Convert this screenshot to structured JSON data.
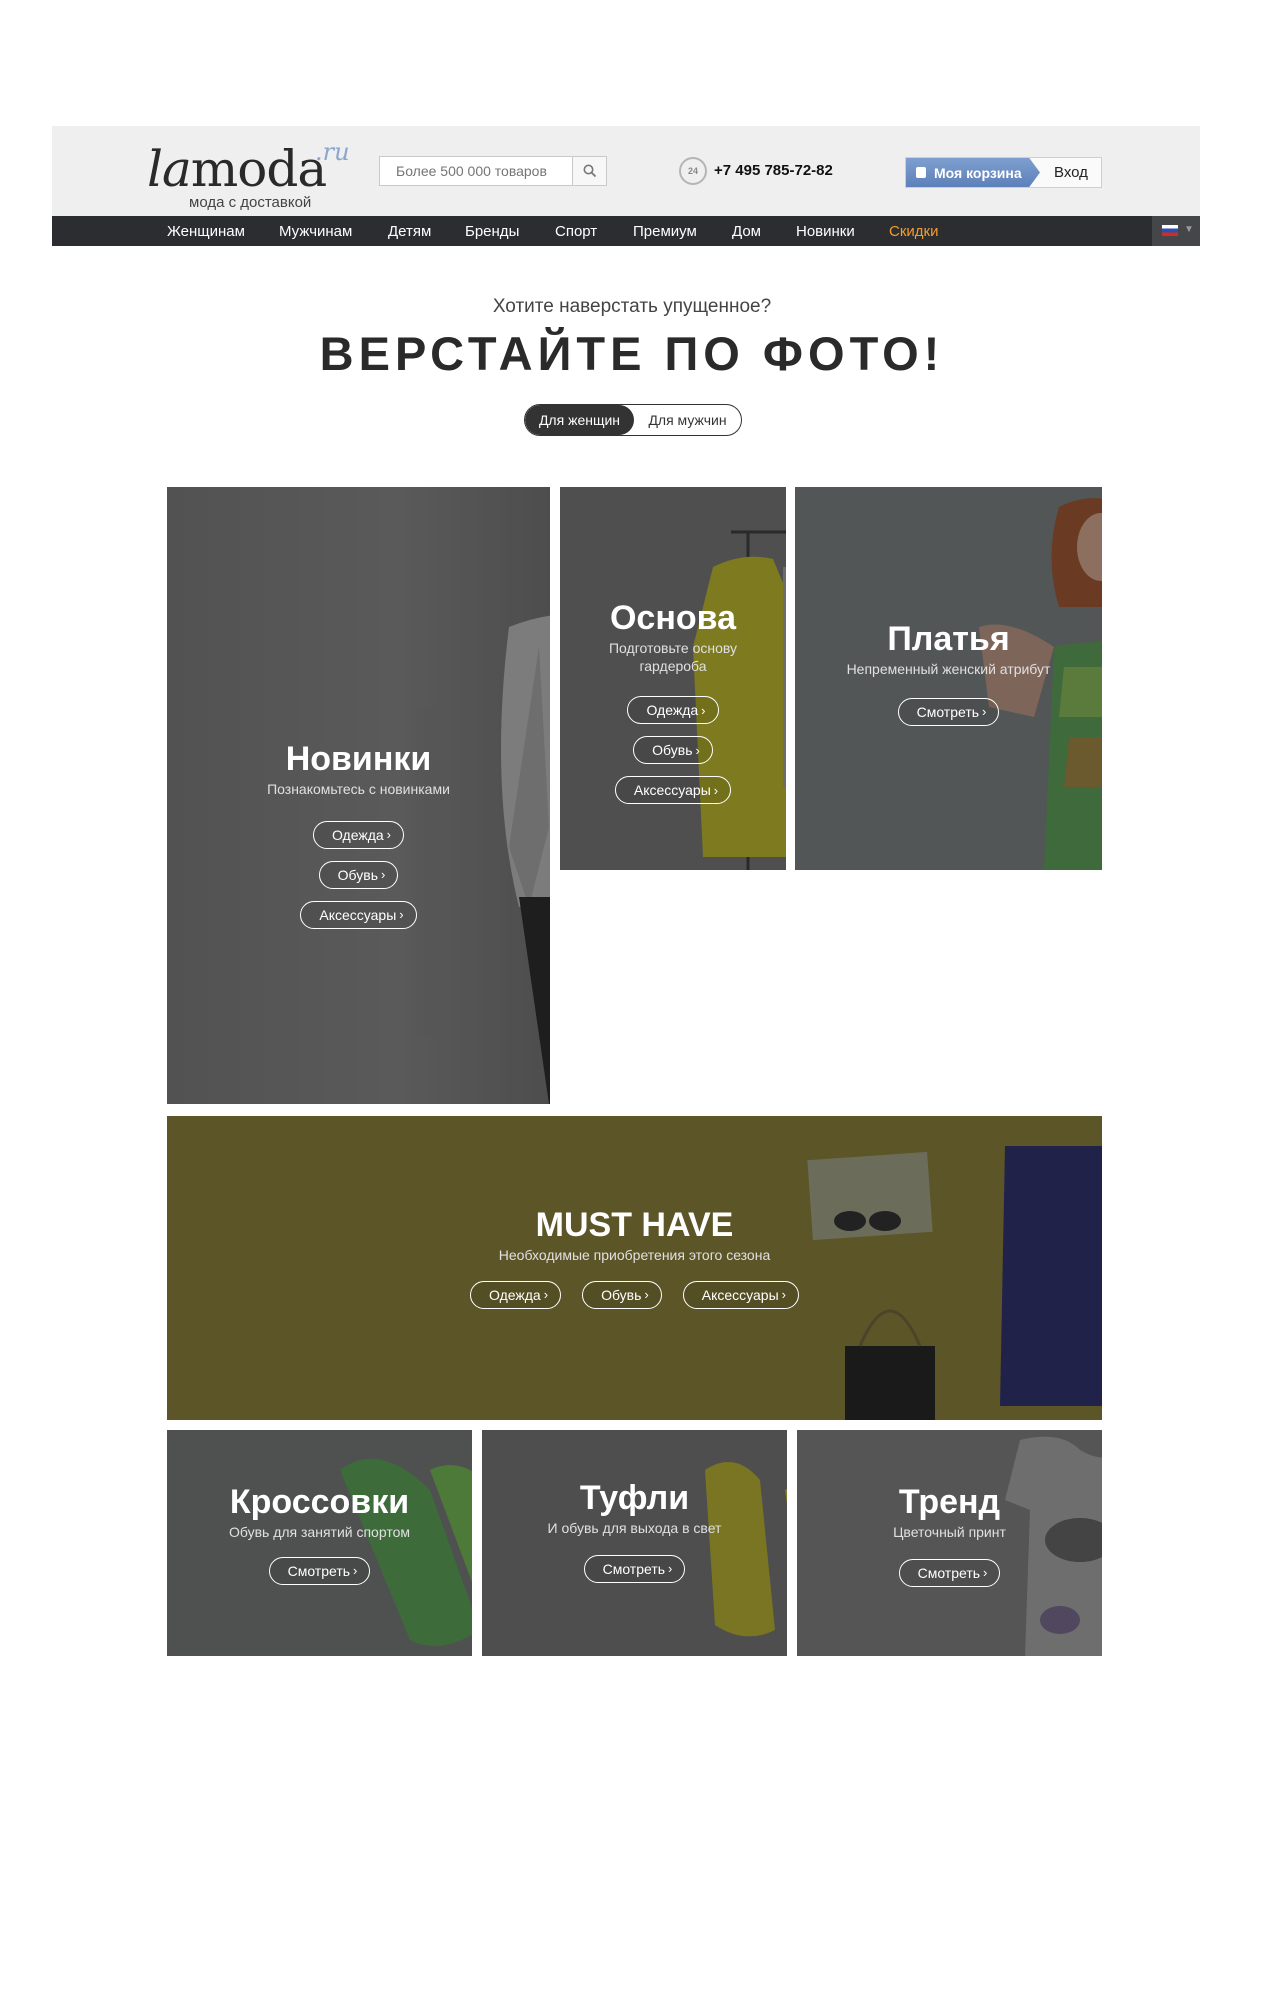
{
  "header": {
    "logo_la": "la",
    "logo_moda": "moda",
    "logo_ru": ".ru",
    "logo_tagline": "мода с доставкой",
    "search_placeholder": "Более 500 000 товаров",
    "phone_icon_text": "24",
    "phone": "+7 495 785-72-82",
    "cart_label": "Моя корзина",
    "login_label": "Вход"
  },
  "nav": {
    "items": [
      "Женщинам",
      "Мужчинам",
      "Детям",
      "Бренды",
      "Спорт",
      "Премиум",
      "Дом",
      "Новинки",
      "Скидки"
    ]
  },
  "hero": {
    "subtitle": "Хотите наверстать упущенное?",
    "title": "ВЕРСТАЙТЕ ПО ФОТО!",
    "toggle_women": "Для женщин",
    "toggle_men": "Для мужчин"
  },
  "tiles": {
    "novinki": {
      "title": "Новинки",
      "desc": "Познакомьтесь с новинками",
      "buttons": [
        "Одежда",
        "Обувь",
        "Аксессуары"
      ]
    },
    "osnova": {
      "title": "Основа",
      "desc_line1": "Подготовьте основу",
      "desc_line2": "гардероба",
      "buttons": [
        "Одежда",
        "Обувь",
        "Аксессуары"
      ]
    },
    "platya": {
      "title": "Платья",
      "desc": "Непременный женский атрибут",
      "button": "Смотреть"
    },
    "musthave": {
      "title": "MUST HAVE",
      "desc": "Необходимые приобретения этого сезона",
      "buttons": [
        "Одежда",
        "Обувь",
        "Аксессуары"
      ]
    },
    "krossovki": {
      "title": "Кроссовки",
      "desc": "Обувь для занятий спортом",
      "button": "Смотреть"
    },
    "tufli": {
      "title": "Туфли",
      "desc": "И обувь для выхода в свет",
      "button": "Смотреть"
    },
    "trend": {
      "title": "Тренд",
      "desc": "Цветочный принт",
      "button": "Смотреть"
    }
  },
  "colors": {
    "nav_bg": "#2c2d30",
    "sale": "#f49d2c",
    "cart": "#6d8fc5",
    "musthave_bg": "#5c5528"
  }
}
